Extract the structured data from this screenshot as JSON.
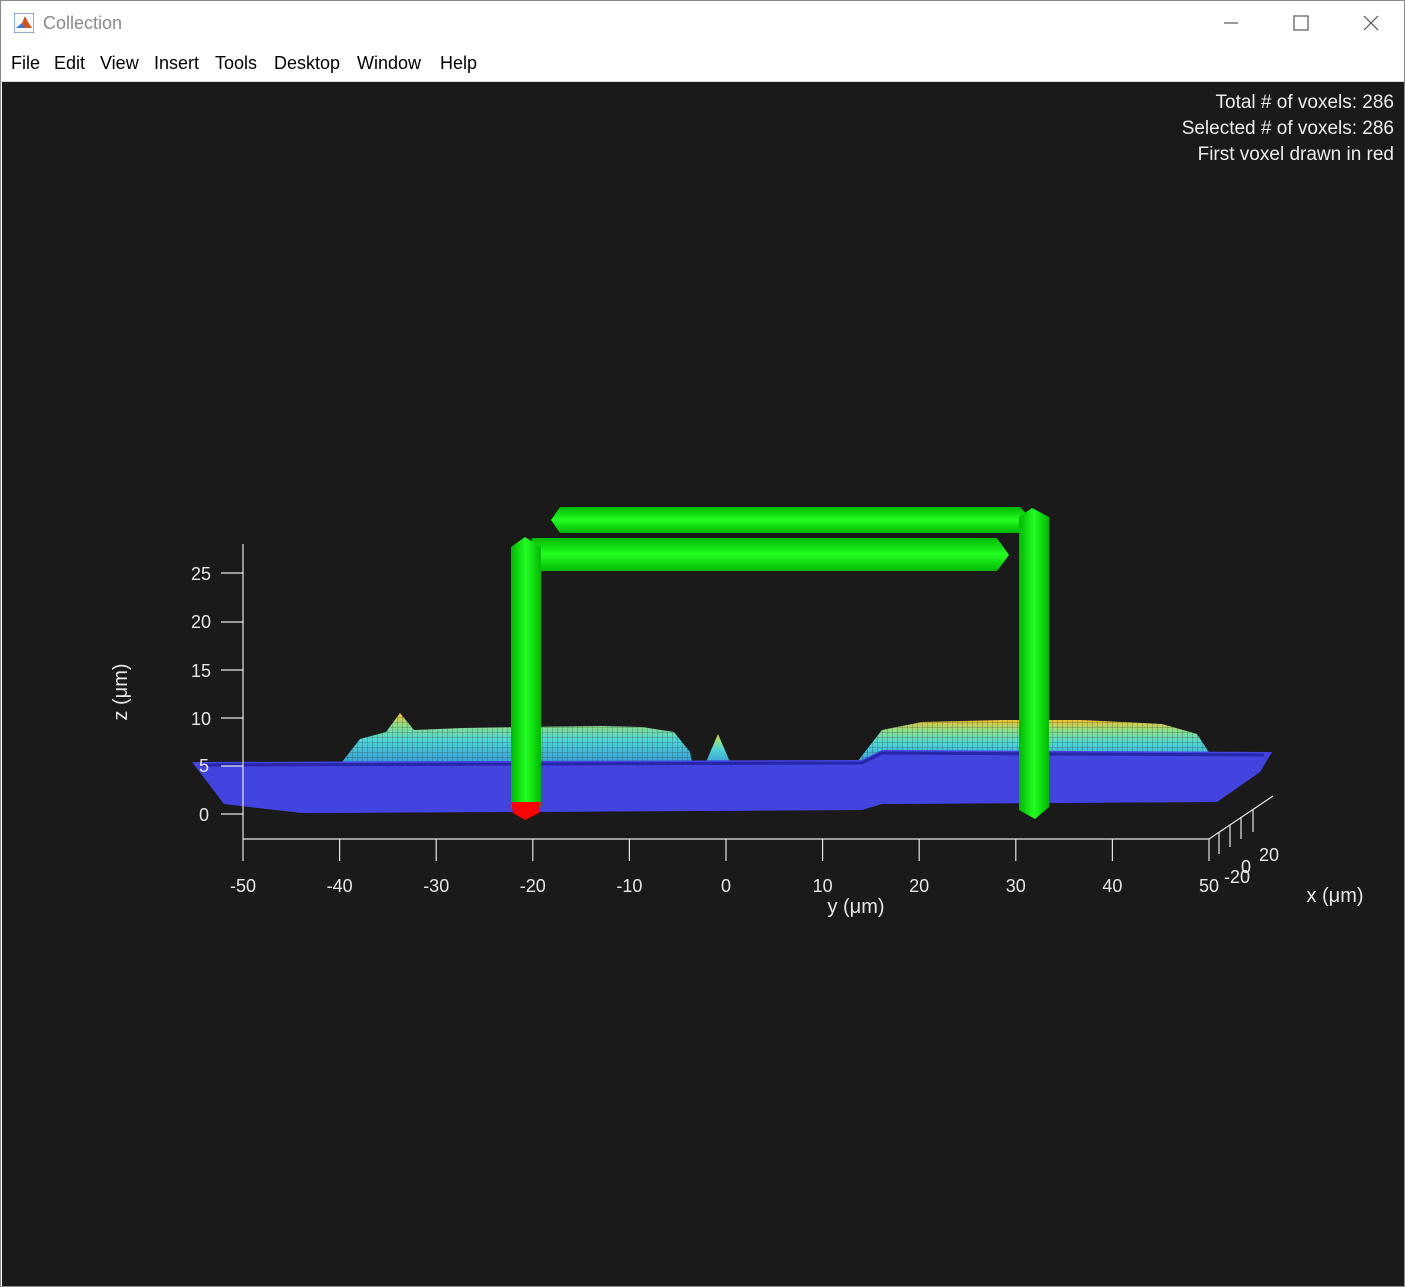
{
  "window": {
    "title": "Collection",
    "icon": "matlab-icon",
    "controls": [
      "minimize-icon",
      "maximize-icon",
      "close-icon"
    ]
  },
  "menu": [
    "File",
    "Edit",
    "View",
    "Insert",
    "Tools",
    "Desktop",
    "Window",
    "Help"
  ],
  "info": {
    "total": "Total # of voxels: 286",
    "selected": "Selected # of voxels: 286",
    "first": "First voxel drawn in red"
  },
  "colors": {
    "figure_bg": "#1a1a1a",
    "axes": "#e6e6e6",
    "skeleton": "#00ee00",
    "first_voxel": "#ff0000",
    "surface_low": "#3a3ad6",
    "surface_mid": "#4fd8d8",
    "surface_high": "#f0c030"
  },
  "chart_data": {
    "type": "3d-surface",
    "view": "side view along x",
    "yaxis": {
      "label": "y (μm)",
      "ticks": [
        -50,
        -40,
        -30,
        -20,
        -10,
        0,
        10,
        20,
        30,
        40,
        50
      ],
      "lim": [
        -50,
        50
      ]
    },
    "zaxis": {
      "label": "z (μm)",
      "ticks": [
        0,
        5,
        10,
        15,
        20,
        25
      ],
      "lim": [
        0,
        27
      ]
    },
    "xaxis": {
      "label": "x (μm)",
      "ticks": [
        -20,
        0,
        20
      ]
    },
    "skeleton": {
      "color": "green",
      "segments": [
        {
          "y": [
            -20.5,
            -20.5
          ],
          "z": [
            0,
            27.5
          ]
        },
        {
          "y": [
            -20.5,
            29
          ],
          "z": [
            27,
            27
          ]
        },
        {
          "y": [
            -17,
            31.5
          ],
          "z": [
            30,
            30
          ]
        },
        {
          "y": [
            31.5,
            31.5
          ],
          "z": [
            0,
            30
          ]
        }
      ]
    },
    "first_voxel": {
      "y": -20.5,
      "z": 0,
      "color": "red"
    },
    "surface": {
      "peaks": [
        {
          "y": -33,
          "z": 10.5
        },
        {
          "y": -0.5,
          "z": 8
        }
      ],
      "plateaus": [
        {
          "y": [
            -38,
            -3
          ],
          "z": 8.7
        },
        {
          "y": [
            14,
            50
          ],
          "z": 9.8
        }
      ],
      "base_z": 5
    }
  }
}
